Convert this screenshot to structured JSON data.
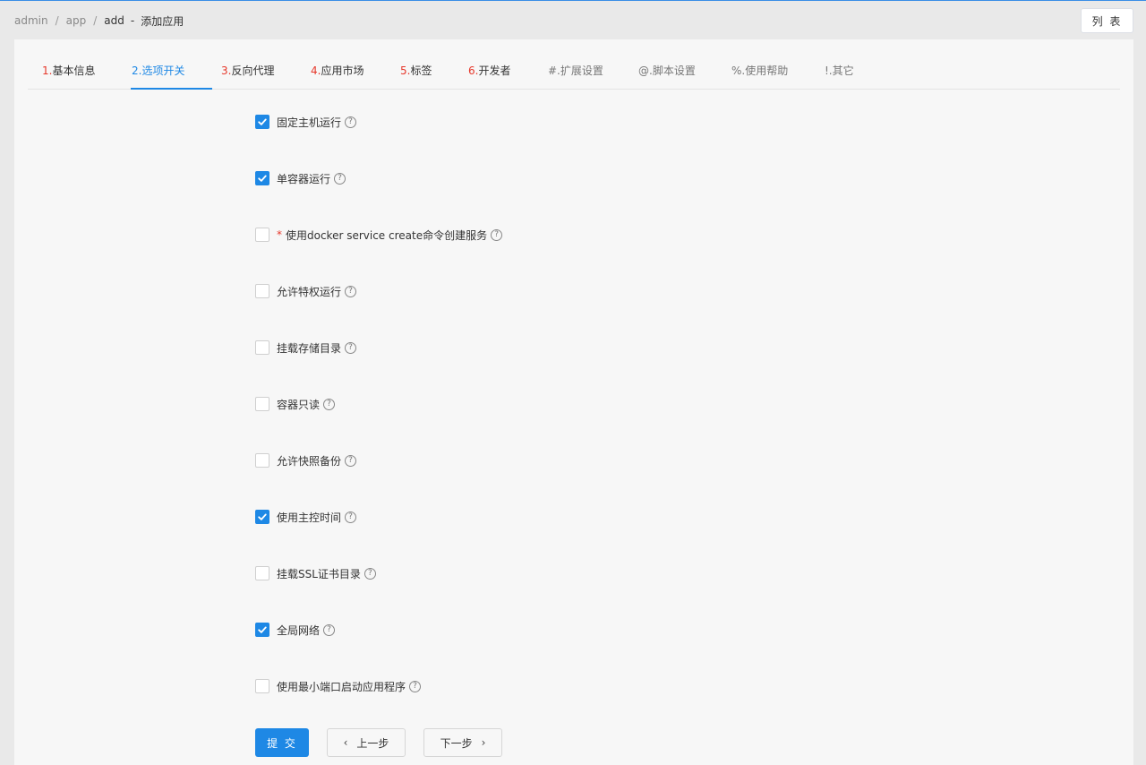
{
  "breadcrumb": {
    "admin": "admin",
    "sep1": "/",
    "app": "app",
    "sep2": "/",
    "add": "add",
    "dash": "-",
    "title": "添加应用"
  },
  "header": {
    "list_button": "列 表"
  },
  "tabs": [
    {
      "num": "1.",
      "label": "基本信息"
    },
    {
      "num": "2.",
      "label": "选项开关"
    },
    {
      "num": "3.",
      "label": "反向代理"
    },
    {
      "num": "4.",
      "label": "应用市场"
    },
    {
      "num": "5.",
      "label": "标签"
    },
    {
      "num": "6.",
      "label": "开发者"
    },
    {
      "num": "",
      "label": "#.扩展设置"
    },
    {
      "num": "",
      "label": "@.脚本设置"
    },
    {
      "num": "",
      "label": "%.使用帮助"
    },
    {
      "num": "",
      "label": "!.其它"
    }
  ],
  "active_tab": "2.选项开关",
  "options": [
    {
      "label": "固定主机运行",
      "checked": true
    },
    {
      "label": "单容器运行",
      "checked": true
    },
    {
      "required": "*",
      "label": "使用docker service create命令创建服务",
      "checked": false
    },
    {
      "label": "允许特权运行",
      "checked": false
    },
    {
      "label": "挂载存储目录",
      "checked": false
    },
    {
      "label": "容器只读",
      "checked": false
    },
    {
      "label": "允许快照备份",
      "checked": false
    },
    {
      "label": "使用主控时间",
      "checked": true
    },
    {
      "label": "挂载SSL证书目录",
      "checked": false
    },
    {
      "label": "全局网络",
      "checked": true
    },
    {
      "label": "使用最小端口启动应用程序",
      "checked": false
    }
  ],
  "help_glyph": "?",
  "actions": {
    "submit": "提 交",
    "prev": "上一步",
    "next": "下一步",
    "prev_icon": "‹",
    "next_icon": "›"
  },
  "colors": {
    "accent": "#1e88e5",
    "required": "#e6382b"
  }
}
